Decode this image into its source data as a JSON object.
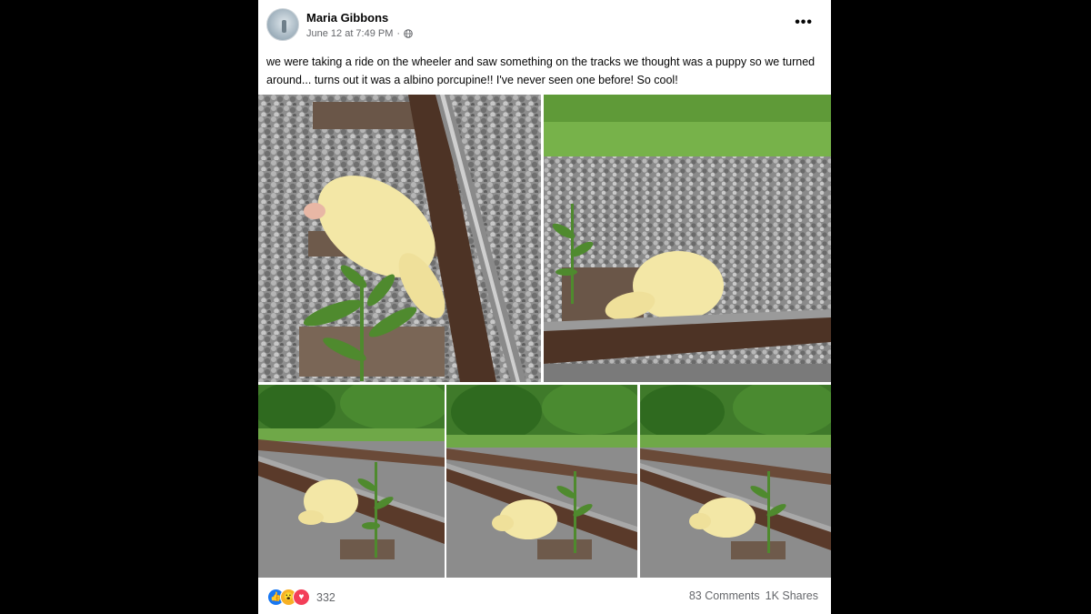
{
  "post": {
    "author": "Maria Gibbons",
    "timestamp": "June 12 at 7:49 PM",
    "meta_separator": "·",
    "more_label": "•••",
    "text": "we were taking a ride on the wheeler and saw something on the tracks we thought was a puppy so we turned around... turns out it was a albino porcupine!! I've never seen one before! So cool!"
  },
  "photos": [
    "photo-1",
    "photo-2",
    "photo-3",
    "photo-4",
    "photo-5"
  ],
  "footer": {
    "reactions": [
      "like-icon",
      "wow-icon",
      "love-icon"
    ],
    "reaction_count": "332",
    "comments": "83 Comments",
    "shares": "1K Shares"
  },
  "colors": {
    "like": "#1877f2",
    "wow": "#f7b125",
    "love": "#f33e58",
    "porcupine": "#f3e7a6",
    "gravel": "#9a9a9a",
    "rail": "#5a3a2a",
    "foliage": "#4f8a2e"
  }
}
